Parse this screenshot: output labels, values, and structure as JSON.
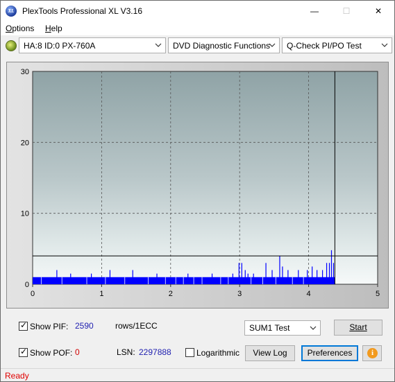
{
  "window": {
    "title": "PlexTools Professional XL V3.16",
    "icon_text": "XL",
    "controls": {
      "minimize": "—",
      "maximize": "☐",
      "close": "✕"
    }
  },
  "menu": {
    "options": {
      "accel": "O",
      "rest": "ptions"
    },
    "help": {
      "accel": "H",
      "rest": "elp"
    }
  },
  "toolbar": {
    "drive": "HA:8 ID:0  PX-760A",
    "function": "DVD Diagnostic Functions",
    "test": "Q-Check PI/PO Test"
  },
  "chart_data": {
    "type": "bar",
    "x_ticks": [
      "0",
      "1",
      "2",
      "3",
      "4",
      "5"
    ],
    "y_ticks": [
      "0",
      "10",
      "20",
      "30"
    ],
    "xlim": [
      0,
      5
    ],
    "ylim": [
      0,
      30
    ],
    "grid": true,
    "threshold_line_y": 4,
    "end_marker_x": 4.38,
    "colors": {
      "bars": "#0000ff",
      "background_top": "#8fa3a6",
      "background_bottom": "#f6f9f9",
      "grid": "#555555"
    },
    "baseline": {
      "x_start": 0.0,
      "x_end": 4.38,
      "value": 1
    },
    "spikes": [
      {
        "x": 0.35,
        "y": 2
      },
      {
        "x": 0.55,
        "y": 1.5
      },
      {
        "x": 0.85,
        "y": 1.5
      },
      {
        "x": 1.12,
        "y": 2
      },
      {
        "x": 1.45,
        "y": 2
      },
      {
        "x": 1.8,
        "y": 1.5
      },
      {
        "x": 2.25,
        "y": 1.5
      },
      {
        "x": 2.6,
        "y": 1.5
      },
      {
        "x": 2.9,
        "y": 1.5
      },
      {
        "x": 2.99,
        "y": 3
      },
      {
        "x": 3.03,
        "y": 3
      },
      {
        "x": 3.08,
        "y": 2
      },
      {
        "x": 3.12,
        "y": 1.5
      },
      {
        "x": 3.2,
        "y": 1.5
      },
      {
        "x": 3.38,
        "y": 3
      },
      {
        "x": 3.47,
        "y": 2
      },
      {
        "x": 3.58,
        "y": 4
      },
      {
        "x": 3.62,
        "y": 2.5
      },
      {
        "x": 3.7,
        "y": 2
      },
      {
        "x": 3.85,
        "y": 2
      },
      {
        "x": 3.98,
        "y": 2
      },
      {
        "x": 4.05,
        "y": 2.5
      },
      {
        "x": 4.12,
        "y": 2
      },
      {
        "x": 4.2,
        "y": 2
      },
      {
        "x": 4.26,
        "y": 3
      },
      {
        "x": 4.3,
        "y": 3
      },
      {
        "x": 4.33,
        "y": 4.8
      },
      {
        "x": 4.36,
        "y": 3
      }
    ]
  },
  "controls_panel": {
    "show_pif_label": "Show PIF:",
    "pif_value": "2590",
    "rows_label": "rows/1ECC",
    "show_pof_label": "Show POF:",
    "pof_value": "0",
    "lsn_label": "LSN:",
    "lsn_value": "2297888",
    "log_label": "Logarithmic",
    "sum_select": "SUM1 Test",
    "start_label": "Start",
    "view_log_label": "View Log",
    "preferences_label": "Preferences",
    "info_glyph": "i",
    "check_glyph": "✓"
  },
  "status": {
    "text": "Ready"
  }
}
